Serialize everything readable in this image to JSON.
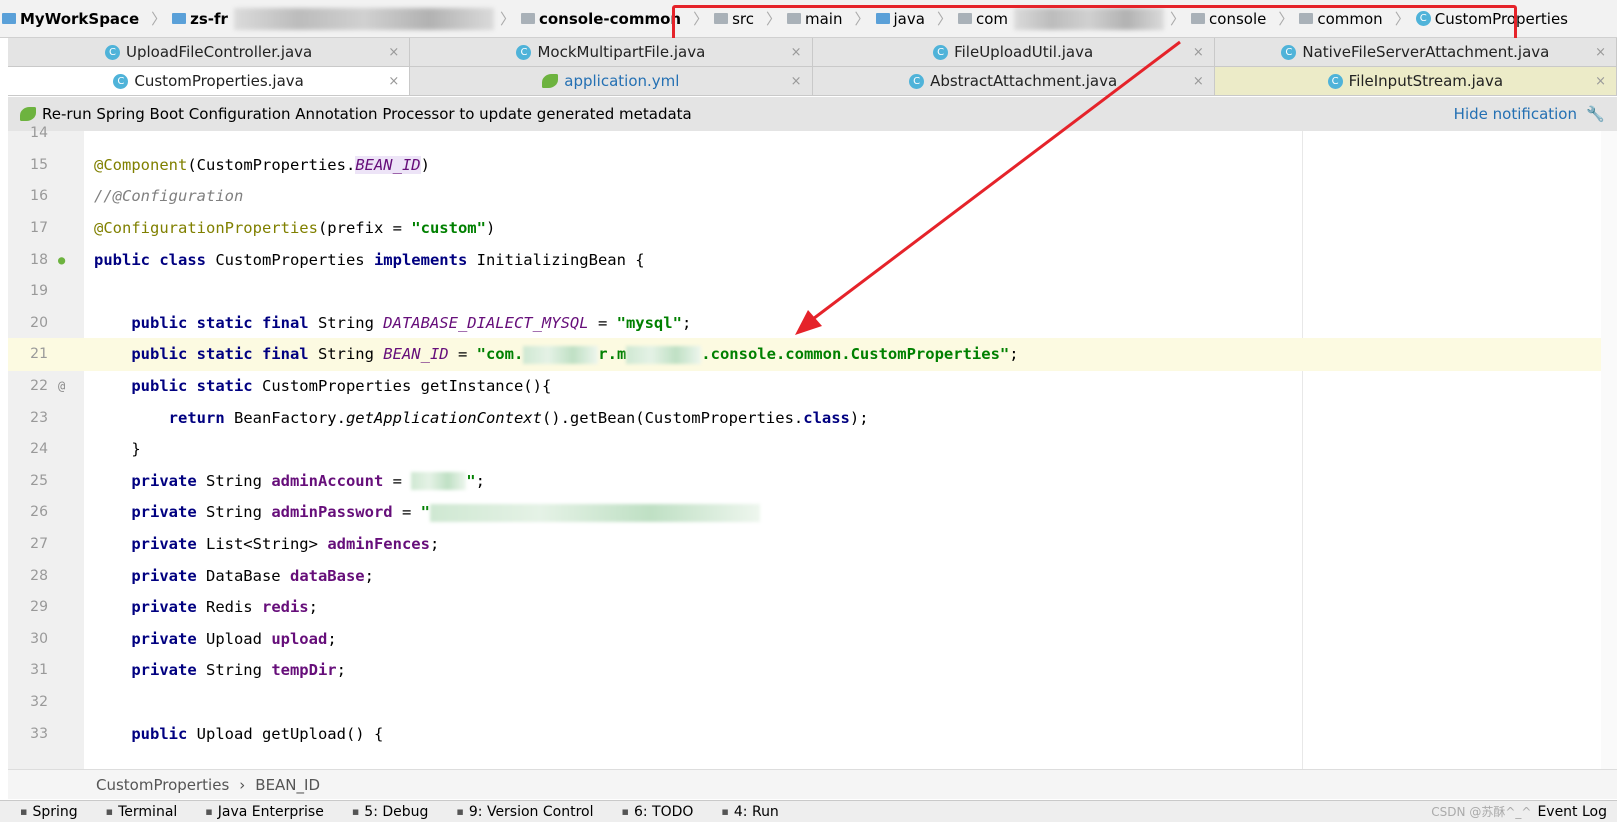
{
  "navbar": {
    "items": [
      {
        "label": "MyWorkSpace",
        "bold": true
      },
      {
        "label": "zs-fr",
        "bold": true
      },
      {
        "label": "console-common",
        "bold": true
      },
      {
        "label": "src"
      },
      {
        "label": "main"
      },
      {
        "label": "java"
      },
      {
        "label": "com"
      },
      {
        "label": "console"
      },
      {
        "label": "common"
      },
      {
        "label": "CustomProperties",
        "class": true
      }
    ]
  },
  "tabs_row1": [
    {
      "label": "UploadFileController.java"
    },
    {
      "label": "MockMultipartFile.java"
    },
    {
      "label": "FileUploadUtil.java"
    },
    {
      "label": "NativeFileServerAttachment.java"
    }
  ],
  "tabs_row2": [
    {
      "label": "CustomProperties.java",
      "active": true
    },
    {
      "label": "application.yml"
    },
    {
      "label": "AbstractAttachment.java"
    },
    {
      "label": "FileInputStream.java"
    }
  ],
  "notification": {
    "text": "Re-run Spring Boot Configuration Annotation Processor to update generated metadata",
    "action": "Hide notification"
  },
  "code": {
    "lines": [
      {
        "n": "14",
        "t": []
      },
      {
        "n": "15",
        "t": [
          [
            "an",
            "@Component"
          ],
          [
            "",
            "(CustomProperties."
          ],
          [
            "sf pill",
            "BEAN_ID"
          ],
          [
            "",
            ")"
          ]
        ]
      },
      {
        "n": "16",
        "t": [
          [
            "cm",
            "//@Configuration"
          ]
        ]
      },
      {
        "n": "17",
        "t": [
          [
            "an",
            "@ConfigurationProperties"
          ],
          [
            "",
            "(prefix = "
          ],
          [
            "str",
            "\"custom\""
          ],
          [
            "",
            ")"
          ]
        ]
      },
      {
        "n": "18",
        "t": [
          [
            "kw",
            "public class "
          ],
          [
            "",
            "CustomProperties "
          ],
          [
            "kw",
            "implements "
          ],
          [
            "",
            "InitializingBean {"
          ]
        ]
      },
      {
        "n": "19",
        "t": []
      },
      {
        "n": "20",
        "t": [
          [
            "kw",
            "    public static final "
          ],
          [
            "",
            "String "
          ],
          [
            "sf",
            "DATABASE_DIALECT_MYSQL"
          ],
          [
            "",
            " = "
          ],
          [
            "str",
            "\"mysql\""
          ],
          [
            "",
            ";"
          ]
        ]
      },
      {
        "n": "21",
        "t": [
          [
            "kw",
            "    public static final "
          ],
          [
            "",
            "String "
          ],
          [
            "sf",
            "BEAN_ID"
          ],
          [
            "",
            " = "
          ],
          [
            "str",
            "\"com."
          ],
          [
            "redact",
            ""
          ],
          [
            "str",
            "r.m"
          ],
          [
            "redact",
            ""
          ],
          [
            "str",
            ".console.common.CustomProperties\""
          ],
          [
            "",
            ";"
          ]
        ],
        "current": true
      },
      {
        "n": "22",
        "t": [
          [
            "kw",
            "    public static "
          ],
          [
            "",
            "CustomProperties getInstance(){"
          ]
        ]
      },
      {
        "n": "23",
        "t": [
          [
            "kw",
            "        return "
          ],
          [
            "",
            "BeanFactory."
          ],
          [
            "it",
            "getApplicationContext"
          ],
          [
            "",
            "().getBean(CustomProperties."
          ],
          [
            "kw",
            "class"
          ],
          [
            "",
            ");"
          ]
        ]
      },
      {
        "n": "24",
        "t": [
          [
            "",
            "    }"
          ]
        ]
      },
      {
        "n": "25",
        "t": [
          [
            "kw",
            "    private "
          ],
          [
            "",
            "String "
          ],
          [
            "fld",
            "adminAccount"
          ],
          [
            "",
            " = "
          ],
          [
            "redact",
            ""
          ],
          [
            "str",
            "\""
          ],
          [
            "",
            ";"
          ]
        ]
      },
      {
        "n": "26",
        "t": [
          [
            "kw",
            "    private "
          ],
          [
            "",
            "String "
          ],
          [
            "fld",
            "adminPassword"
          ],
          [
            "",
            " = "
          ],
          [
            "str",
            "\""
          ],
          [
            "redact",
            ""
          ]
        ]
      },
      {
        "n": "27",
        "t": [
          [
            "kw",
            "    private "
          ],
          [
            "",
            "List<String> "
          ],
          [
            "fld",
            "adminFences"
          ],
          [
            "",
            ";"
          ]
        ]
      },
      {
        "n": "28",
        "t": [
          [
            "kw",
            "    private "
          ],
          [
            "",
            "DataBase "
          ],
          [
            "fld",
            "dataBase"
          ],
          [
            "",
            ";"
          ]
        ]
      },
      {
        "n": "29",
        "t": [
          [
            "kw",
            "    private "
          ],
          [
            "",
            "Redis "
          ],
          [
            "fld",
            "redis"
          ],
          [
            "",
            ";"
          ]
        ]
      },
      {
        "n": "30",
        "t": [
          [
            "kw",
            "    private "
          ],
          [
            "",
            "Upload "
          ],
          [
            "fld",
            "upload"
          ],
          [
            "",
            ";"
          ]
        ]
      },
      {
        "n": "31",
        "t": [
          [
            "kw",
            "    private "
          ],
          [
            "",
            "String "
          ],
          [
            "fld",
            "tempDir"
          ],
          [
            "",
            ";"
          ]
        ]
      },
      {
        "n": "32",
        "t": []
      },
      {
        "n": "33",
        "t": [
          [
            "kw",
            "    public "
          ],
          [
            "",
            "Upload getUpload() {"
          ]
        ]
      }
    ]
  },
  "breadcrumb": {
    "class": "CustomProperties",
    "member": "BEAN_ID"
  },
  "toolwindows": [
    {
      "label": "Spring",
      "icon": "spring-icon"
    },
    {
      "label": "Terminal",
      "icon": "terminal-icon"
    },
    {
      "label": "Java Enterprise",
      "icon": "java-enterprise-icon"
    },
    {
      "label": "5: Debug",
      "icon": "debug-icon"
    },
    {
      "label": "9: Version Control",
      "icon": "vcs-icon"
    },
    {
      "label": "6: TODO",
      "icon": "todo-icon"
    },
    {
      "label": "4: Run",
      "icon": "run-icon"
    }
  ],
  "event_log": "Event Log",
  "watermark": "CSDN @苏酥^_^",
  "colors": {
    "highlight": "#e5232a",
    "keyword": "#000080",
    "string": "#008000",
    "field": "#660e7a",
    "annotation": "#808000"
  }
}
